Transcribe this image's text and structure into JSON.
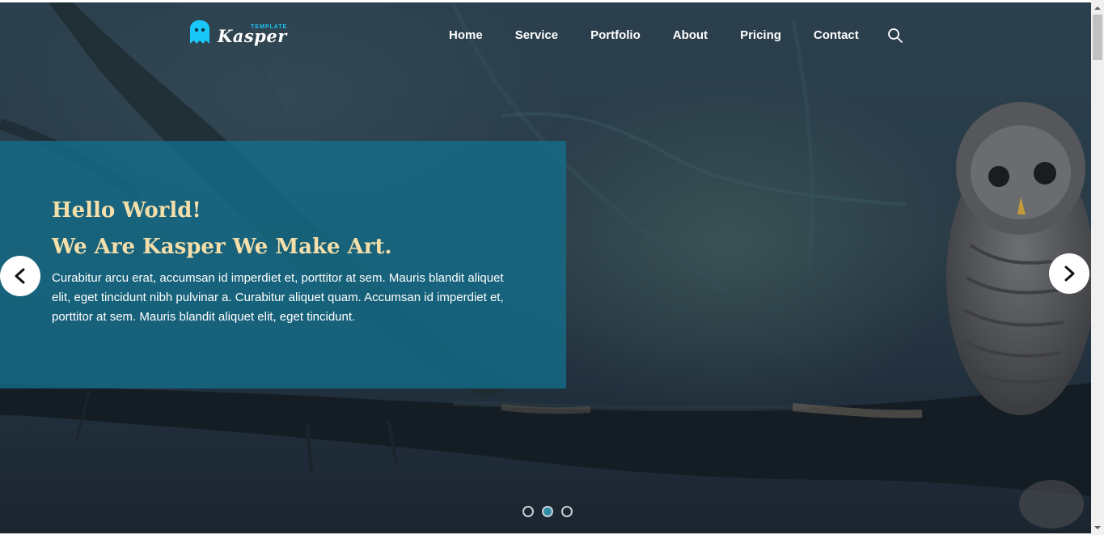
{
  "header": {
    "logo_name": "Kasper",
    "logo_tag": "TEMPLATE",
    "logo_icon": "ghost-icon",
    "nav": [
      {
        "label": "Home"
      },
      {
        "label": "Service"
      },
      {
        "label": "Portfolio"
      },
      {
        "label": "About"
      },
      {
        "label": "Pricing"
      },
      {
        "label": "Contact"
      }
    ],
    "search_icon": "search-icon"
  },
  "slider": {
    "title": "Hello World!",
    "subtitle": "We Are Kasper We Make Art.",
    "text": "Curabitur arcu erat, accumsan id imperdiet et, porttitor at sem. Mauris blandit aliquet elit, eget tincidunt nibh pulvinar a. Curabitur aliquet quam. Accumsan id imperdiet et, porttitor at sem. Mauris blandit aliquet elit, eget tincidunt.",
    "prev_icon": "chevron-left-icon",
    "next_icon": "chevron-right-icon",
    "slide_count": 3,
    "active_slide": 2
  },
  "colors": {
    "accent": "#19c8fa",
    "caption_bg": "#136e8c",
    "heading": "#f4dfaa",
    "active_dot": "#2f8ea3"
  }
}
